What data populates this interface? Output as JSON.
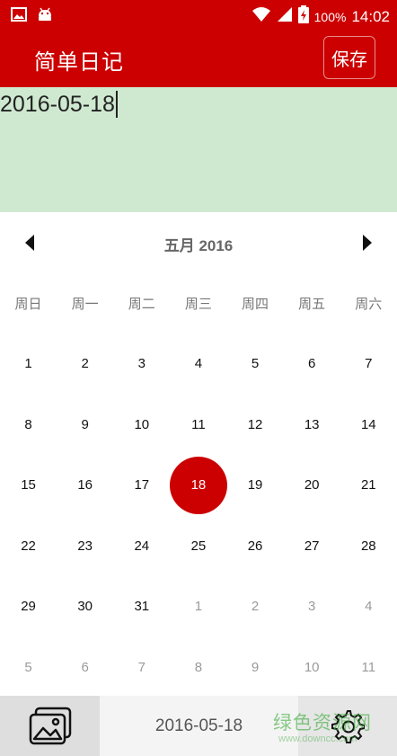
{
  "status_bar": {
    "left_icons": [
      "image-icon",
      "android-icon"
    ],
    "right_icons": [
      "wifi-icon",
      "signal-icon",
      "battery-charging-icon"
    ],
    "battery": "100%",
    "time": "14:02"
  },
  "app_bar": {
    "title": "简单日记",
    "save_label": "保存"
  },
  "editor": {
    "text": "2016-05-18"
  },
  "calendar": {
    "month_label": "五月 2016",
    "weekdays": [
      "周日",
      "周一",
      "周二",
      "周三",
      "周四",
      "周五",
      "周六"
    ],
    "selected_day": "18",
    "days": [
      {
        "label": "1",
        "other": false
      },
      {
        "label": "2",
        "other": false
      },
      {
        "label": "3",
        "other": false
      },
      {
        "label": "4",
        "other": false
      },
      {
        "label": "5",
        "other": false
      },
      {
        "label": "6",
        "other": false
      },
      {
        "label": "7",
        "other": false
      },
      {
        "label": "8",
        "other": false
      },
      {
        "label": "9",
        "other": false
      },
      {
        "label": "10",
        "other": false
      },
      {
        "label": "11",
        "other": false
      },
      {
        "label": "12",
        "other": false
      },
      {
        "label": "13",
        "other": false
      },
      {
        "label": "14",
        "other": false
      },
      {
        "label": "15",
        "other": false
      },
      {
        "label": "16",
        "other": false
      },
      {
        "label": "17",
        "other": false
      },
      {
        "label": "18",
        "other": false,
        "selected": true
      },
      {
        "label": "19",
        "other": false
      },
      {
        "label": "20",
        "other": false
      },
      {
        "label": "21",
        "other": false
      },
      {
        "label": "22",
        "other": false
      },
      {
        "label": "23",
        "other": false
      },
      {
        "label": "24",
        "other": false
      },
      {
        "label": "25",
        "other": false
      },
      {
        "label": "26",
        "other": false
      },
      {
        "label": "27",
        "other": false
      },
      {
        "label": "28",
        "other": false
      },
      {
        "label": "29",
        "other": false
      },
      {
        "label": "30",
        "other": false
      },
      {
        "label": "31",
        "other": false
      },
      {
        "label": "1",
        "other": true
      },
      {
        "label": "2",
        "other": true
      },
      {
        "label": "3",
        "other": true
      },
      {
        "label": "4",
        "other": true
      },
      {
        "label": "5",
        "other": true
      },
      {
        "label": "6",
        "other": true
      },
      {
        "label": "7",
        "other": true
      },
      {
        "label": "8",
        "other": true
      },
      {
        "label": "9",
        "other": true
      },
      {
        "label": "10",
        "other": true
      },
      {
        "label": "11",
        "other": true
      }
    ]
  },
  "bottom_bar": {
    "date_label": "2016-05-18",
    "watermark": "绿色资源网",
    "watermark_url": "www.downcc.com"
  },
  "colors": {
    "primary": "#cc0000",
    "editor_bg": "#cfe9d1"
  }
}
